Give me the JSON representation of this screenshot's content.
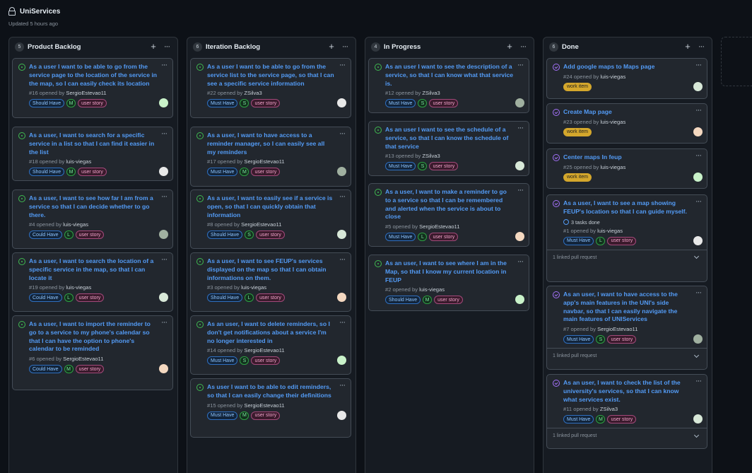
{
  "header": {
    "title": "UniServices",
    "updated": "Updated 5 hours ago"
  },
  "colors": {
    "bg": "#0d1117",
    "open": "#3fb950",
    "closed": "#a371f7",
    "link": "#539bf5"
  },
  "columns": [
    {
      "name": "Product Backlog",
      "count": "5",
      "add": "+",
      "more": "···",
      "cards": [
        {
          "state": "open",
          "title": "As a user I want to be able to go from the service page to the location of the service in the map, so I can easily check its location",
          "num": "#16 opened by",
          "author": "SergioEstevao11",
          "labels": [
            "Should Have",
            "user story"
          ],
          "size": "M"
        },
        {
          "state": "open",
          "title": "As a user, I want to search for a specific service in a list so that I can find it easier in the list",
          "num": "#18 opened by",
          "author": "luis-viegas",
          "labels": [
            "Should Have",
            "user story"
          ],
          "size": "M"
        },
        {
          "state": "open",
          "title": "As a user, I want to see how far I am from a service so that I can decide whether to go there.",
          "num": "#4 opened by",
          "author": "luis-viegas",
          "labels": [
            "Could Have",
            "user story"
          ],
          "size": "L"
        },
        {
          "state": "open",
          "title": "As a user, I want to search the location of a specific service in the map, so that I can locate it",
          "num": "#19 opened by",
          "author": "luis-viegas",
          "labels": [
            "Could Have",
            "user story"
          ],
          "size": "L"
        },
        {
          "state": "open",
          "title": "As a user, I want to import the reminder to go to a service to my phone's calendar so that I can have the option to phone's calendar to be reminded",
          "num": "#6 opened by",
          "author": "SergioEstevao11",
          "labels": [
            "Could Have",
            "user story"
          ],
          "size": "M"
        }
      ]
    },
    {
      "name": "Iteration Backlog",
      "count": "6",
      "add": "+",
      "more": "···",
      "cards": [
        {
          "state": "open",
          "title": "As a user I want to be able to go from the service list to the service page, so that I can see a specific service information",
          "num": "#22 opened by",
          "author": "ZSilva3",
          "labels": [
            "Must Have",
            "user story"
          ],
          "size": "S"
        },
        {
          "state": "open",
          "title": "As a user, I want to have access to a reminder manager, so I can easily see all my reminders",
          "num": "#17 opened by",
          "author": "SergioEstevao11",
          "labels": [
            "Must Have",
            "user story"
          ],
          "size": "M"
        },
        {
          "state": "open",
          "title": "As a user, I want to easily see if a service is open, so that I can quickly obtain that information",
          "num": "#8 opened by",
          "author": "SergioEstevao11",
          "labels": [
            "Should Have",
            "user story"
          ],
          "size": "S"
        },
        {
          "state": "open",
          "title": "As a user, I want to see FEUP's services displayed on the map so that I can obtain informations on them.",
          "num": "#3 opened by",
          "author": "luis-viegas",
          "labels": [
            "Should Have",
            "user story"
          ],
          "size": "L"
        },
        {
          "state": "open",
          "title": "As an user, I want to delete reminders, so I don't get notifications about a service I'm no longer interested in",
          "num": "#14 opened by",
          "author": "SergioEstevao11",
          "labels": [
            "Must Have",
            "user story"
          ],
          "size": "S"
        },
        {
          "state": "open",
          "title": "As user I want to be able to edit reminders, so that I can easily change their definitions",
          "num": "#15 opened by",
          "author": "SergioEstevao11",
          "labels": [
            "Must Have",
            "user story"
          ],
          "size": "M"
        }
      ]
    },
    {
      "name": "In Progress",
      "count": "4",
      "add": "+",
      "more": "···",
      "cards": [
        {
          "state": "open",
          "title": "As an user I want to see the description of a service, so that I can know what that service is.",
          "num": "#12 opened by",
          "author": "ZSilva3",
          "labels": [
            "Must Have",
            "user story"
          ],
          "size": "S"
        },
        {
          "state": "open",
          "title": "As an user I want to see the schedule of a service, so that I can know the schedule of that service",
          "num": "#13 opened by",
          "author": "ZSilva3",
          "labels": [
            "Must Have",
            "user story"
          ],
          "size": "S"
        },
        {
          "state": "open",
          "title": "As a user, I want to make a reminder to go to a service so that I can be remembered and alerted when the service is about to close",
          "num": "#5 opened by",
          "author": "SergioEstevao11",
          "labels": [
            "Must Have",
            "user story"
          ],
          "size": "L"
        },
        {
          "state": "open",
          "title": "As an user, I want to see where I am in the Map, so that I know my current location in FEUP",
          "num": "#2 opened by",
          "author": "luis-viegas",
          "labels": [
            "Should Have",
            "user story"
          ],
          "size": "M"
        }
      ]
    },
    {
      "name": "Done",
      "count": "6",
      "add": "+",
      "more": "···",
      "cards": [
        {
          "state": "closed",
          "title": "Add google maps to Maps page",
          "num": "#24 opened by",
          "author": "luis-viegas",
          "labels": [
            "work item"
          ]
        },
        {
          "state": "closed",
          "title": "Create Map page",
          "num": "#23 opened by",
          "author": "luis-viegas",
          "labels": [
            "work item"
          ]
        },
        {
          "state": "closed",
          "title": "Center maps In feup",
          "num": "#25 opened by",
          "author": "luis-viegas",
          "labels": [
            "work item"
          ]
        },
        {
          "state": "closed",
          "title": "As a user, I want to see a map showing FEUP's location so that I can guide myself.",
          "tasks": "3 tasks done",
          "num": "#1 opened by",
          "author": "luis-viegas",
          "labels": [
            "Must Have",
            "user story"
          ],
          "size": "L",
          "pr": "1 linked pull request"
        },
        {
          "state": "closed",
          "title": "As an user, I want to have access to the app's main features in the UNI's side navbar, so that I can easily navigate the main features of UNIServices",
          "num": "#7 opened by",
          "author": "SergioEstevao11",
          "labels": [
            "Must Have",
            "user story"
          ],
          "size": "S",
          "pr": "1 linked pull request"
        },
        {
          "state": "closed",
          "title": "As an user, I want to check the list of the university's services, so that I can know what services exist.",
          "num": "#11 opened by",
          "author": "ZSilva3",
          "labels": [
            "Must Have",
            "user story"
          ],
          "size": "M",
          "pr": "1 linked pull request"
        }
      ]
    }
  ]
}
